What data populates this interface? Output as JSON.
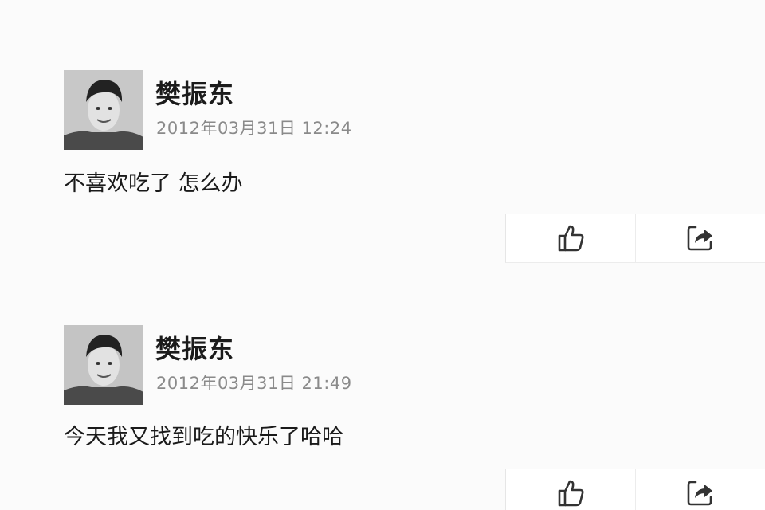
{
  "posts": [
    {
      "author": "樊振东",
      "timestamp": "2012年03月31日 12:24",
      "content": "不喜欢吃了 怎么办",
      "actions": [
        {
          "icon": "thumbs-up-icon"
        },
        {
          "icon": "share-icon"
        }
      ]
    },
    {
      "author": "樊振东",
      "timestamp": "2012年03月31日 21:49",
      "content": "今天我又找到吃的快乐了哈哈",
      "actions": [
        {
          "icon": "thumbs-up-icon"
        },
        {
          "icon": "share-icon"
        }
      ]
    }
  ]
}
